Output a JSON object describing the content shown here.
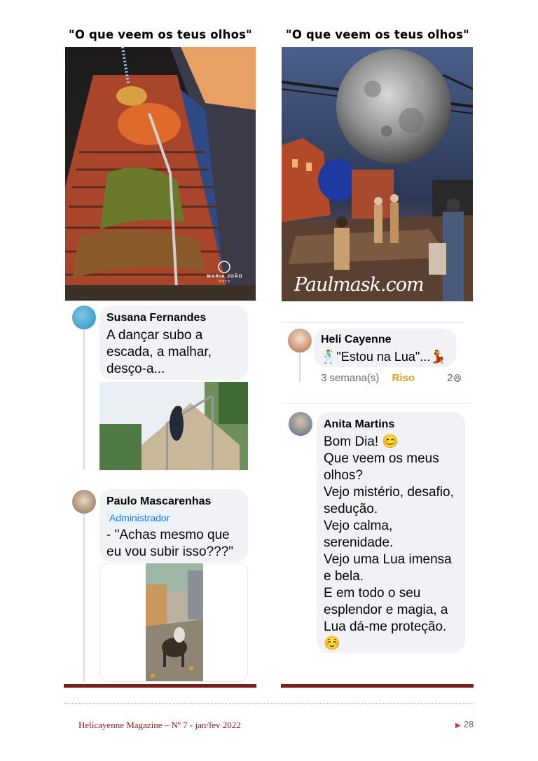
{
  "titles": {
    "left": "\"O que veem os teus olhos\"",
    "right": "\"O que veem os teus olhos\""
  },
  "photos": {
    "left_watermark": "MARIA JOÃO",
    "left_watermark_sub": "FOTO",
    "right_watermark": "Paulmask.com"
  },
  "comments": {
    "susana": {
      "name": "Susana Fernandes",
      "text": "A dançar subo a\nescada, a malhar,\ndesço-a..."
    },
    "paulo": {
      "name": "Paulo Mascarenhas",
      "badge": "Administrador",
      "text": "- \"Achas mesmo que\neu vou subir isso???\""
    },
    "heli": {
      "name": "Heli Cayenne",
      "emoji_before": "🕺",
      "text": "\"Estou na Lua\"...",
      "emoji_after": "💃",
      "time": "3 semana(s)",
      "reaction_label": "Riso",
      "reaction_count": "2",
      "reaction_emoji": "😆"
    },
    "anita": {
      "name": "Anita Martins",
      "text": "Bom Dia! 😊\nQue veem os meus\nolhos?\nVejo mistério, desafio,\nsedução.\nVejo calma,\nserenidade.\nVejo uma Lua imensa\ne bela.\nE em todo o seu\nesplendor e magia, a\nLua dá-me proteção.\n☺️"
    }
  },
  "footer": {
    "left": "Helicayenne Magazine – Nº 7 -  jan/fev 2022",
    "page_number": "28"
  },
  "colors": {
    "footer_bar": "#7a1f1f",
    "footer_text": "#8b1c1c",
    "bubble_bg": "#f0f2f5",
    "admin_badge": "#1877f2"
  }
}
